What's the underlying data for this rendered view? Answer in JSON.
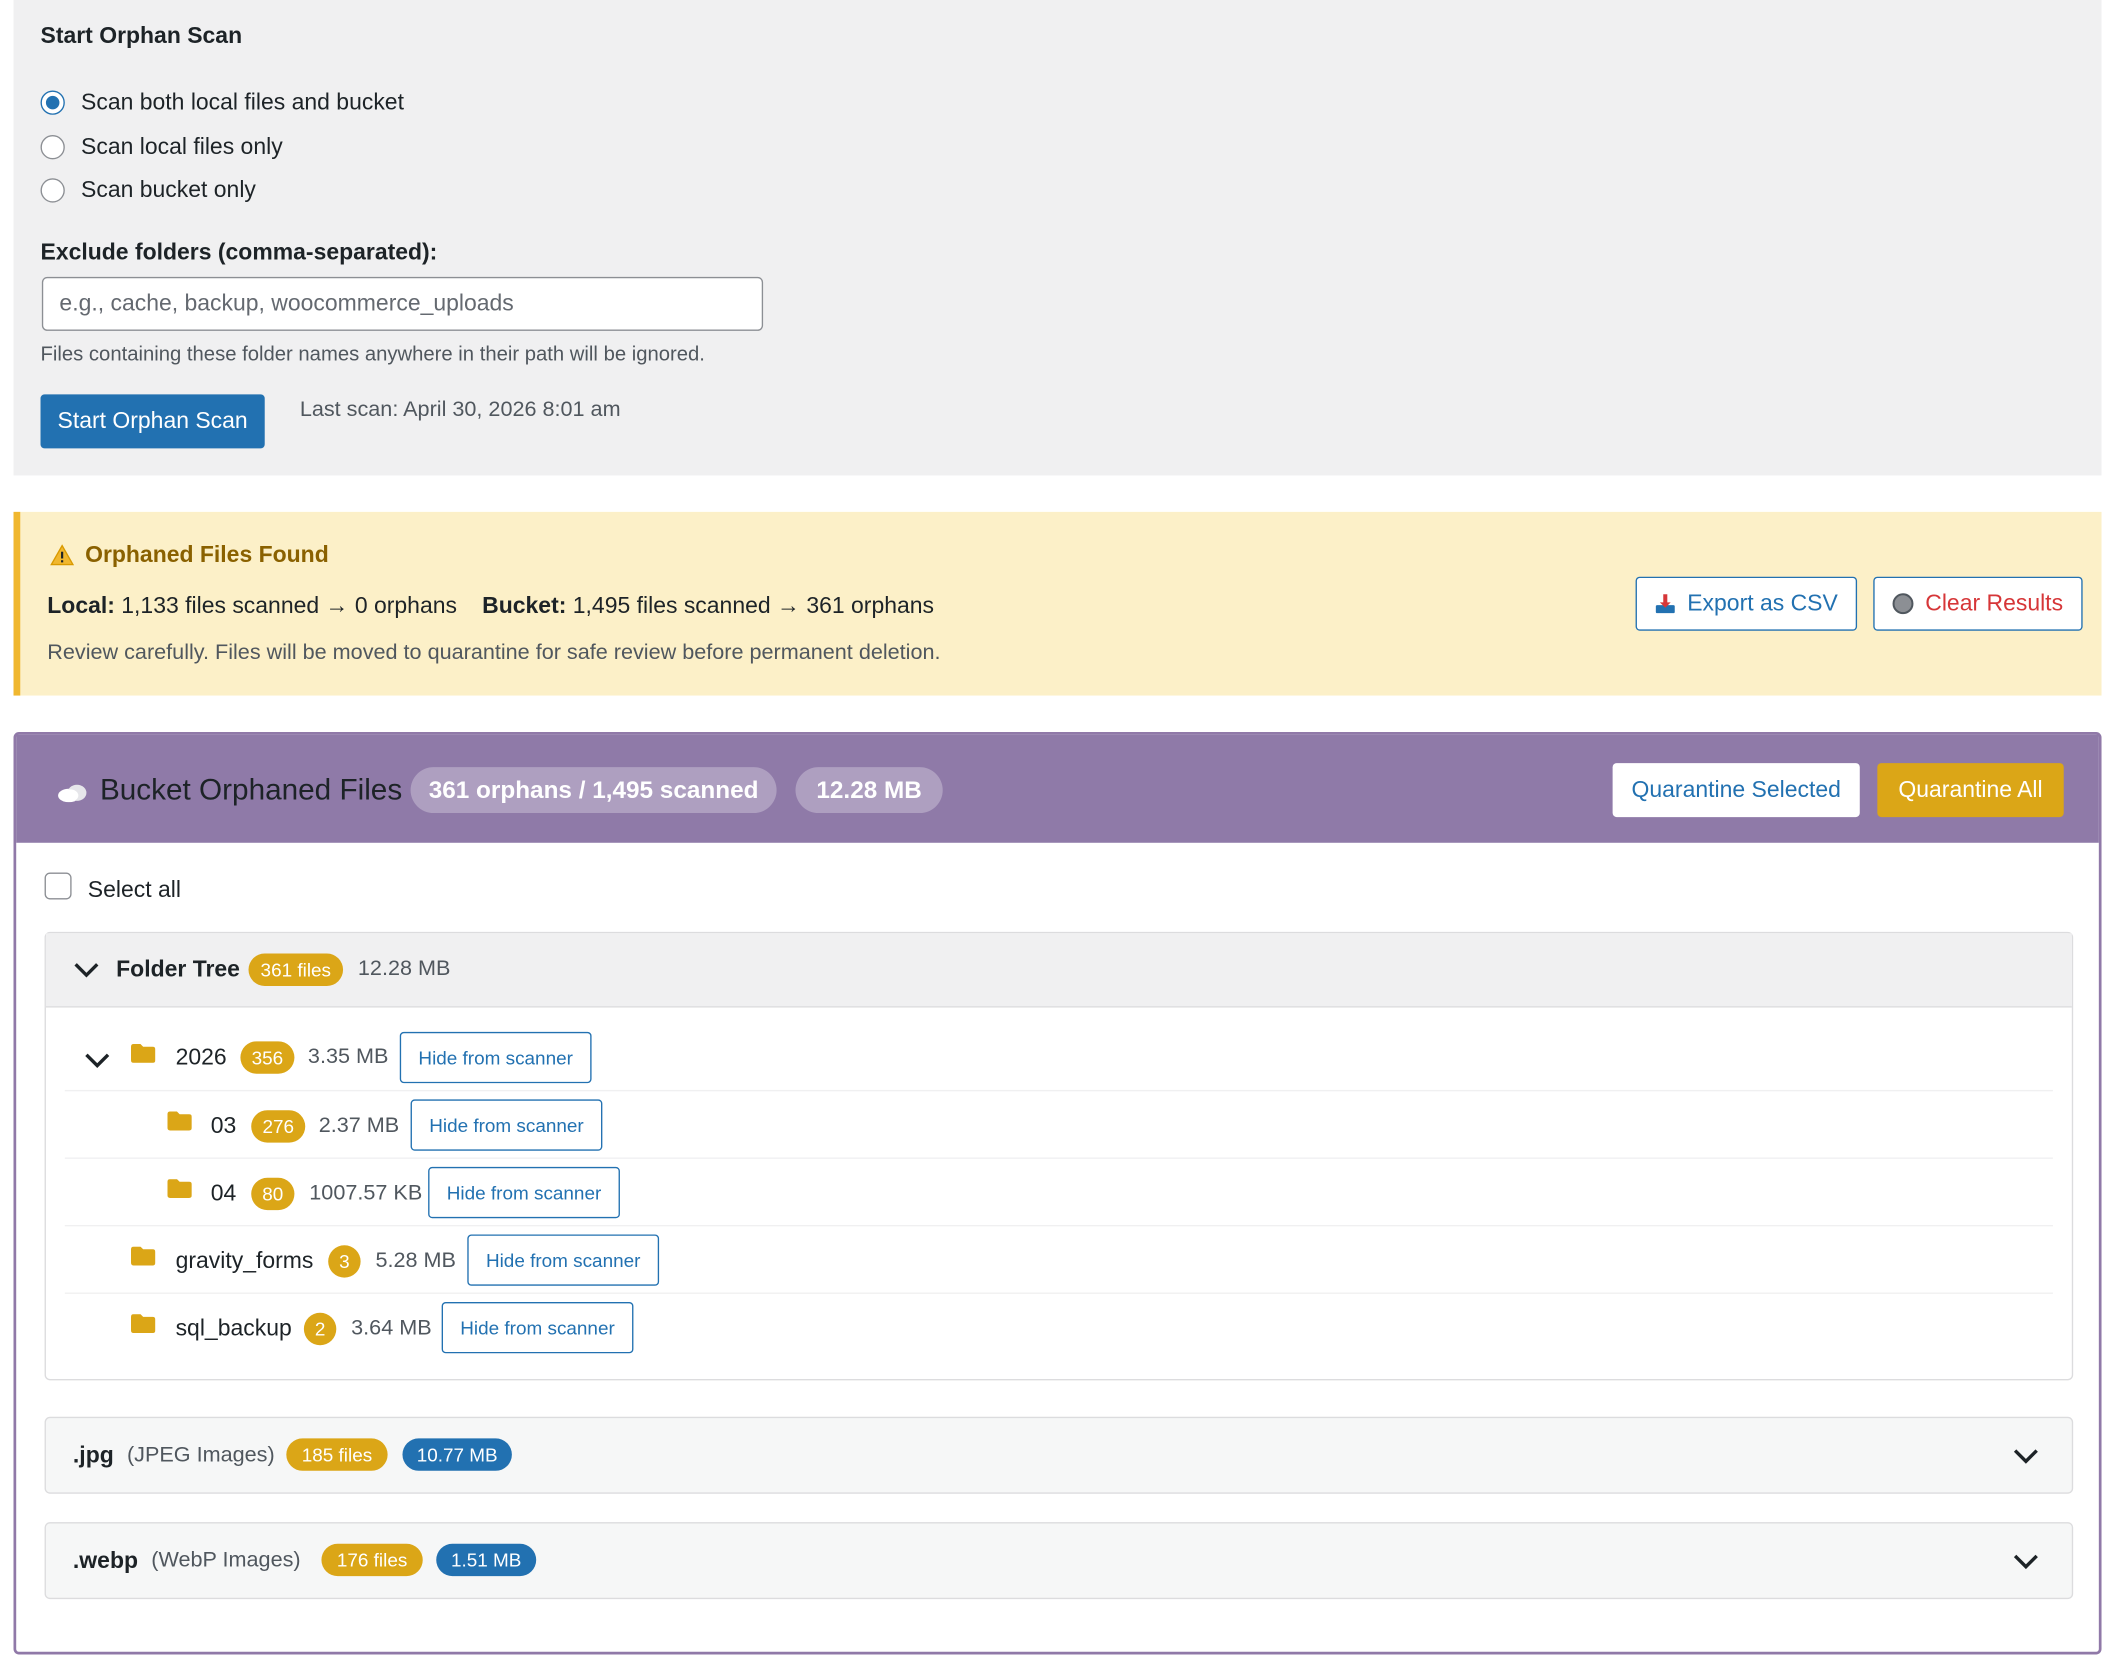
{
  "scan": {
    "title": "Start Orphan Scan",
    "options": [
      {
        "label": "Scan both local files and bucket",
        "selected": true
      },
      {
        "label": "Scan local files only",
        "selected": false
      },
      {
        "label": "Scan bucket only",
        "selected": false
      }
    ],
    "exclude_label": "Exclude folders (comma-separated):",
    "exclude_placeholder": "e.g., cache, backup, woocommerce_uploads",
    "exclude_help": "Files containing these folder names anywhere in their path will be ignored.",
    "start_button": "Start Orphan Scan",
    "last_scan": "Last scan: April 30, 2026 8:01 am"
  },
  "notice": {
    "title": "Orphaned Files Found",
    "local_label": "Local:",
    "local_text": "1,133 files scanned → 0 orphans",
    "bucket_label": "Bucket:",
    "bucket_text": "1,495 files scanned → 361 orphans",
    "note": "Review carefully. Files will be moved to quarantine for safe review before permanent deletion.",
    "export_button": "Export as CSV",
    "clear_button": "Clear Results"
  },
  "bucket": {
    "title": "Bucket Orphaned Files",
    "count_pill": "361 orphans / 1,495 scanned",
    "size_pill": "12.28 MB",
    "quarantine_selected": "Quarantine Selected",
    "quarantine_all": "Quarantine All",
    "select_all": "Select all",
    "tree": {
      "label": "Folder Tree",
      "badge": "361 files",
      "size": "12.28 MB",
      "hide_label": "Hide from scanner",
      "rows": [
        {
          "name": "2026",
          "badge": "356",
          "size": "3.35 MB"
        },
        {
          "name": "03",
          "badge": "276",
          "size": "2.37 MB"
        },
        {
          "name": "04",
          "badge": "80",
          "size": "1007.57 KB"
        },
        {
          "name": "gravity_forms",
          "badge": "3",
          "size": "5.28 MB"
        },
        {
          "name": "sql_backup",
          "badge": "2",
          "size": "3.64 MB"
        }
      ]
    },
    "extensions": [
      {
        "ext": ".jpg",
        "desc": "(JPEG Images)",
        "files": "185 files",
        "size": "10.77 MB"
      },
      {
        "ext": ".webp",
        "desc": "(WebP Images)",
        "files": "176 files",
        "size": "1.51 MB"
      }
    ]
  },
  "colors": {
    "primary": "#2271b1",
    "warning_bg": "#fcf0c8",
    "bucket_header": "#8f7aa8",
    "badge": "#dba617",
    "danger": "#d63638"
  },
  "icons": {
    "warning": "warning-icon",
    "export": "download-icon",
    "clear": "circle-icon",
    "bucket": "cloud-icon",
    "folder": "folder-icon",
    "toggle": "chevron-down-icon"
  }
}
